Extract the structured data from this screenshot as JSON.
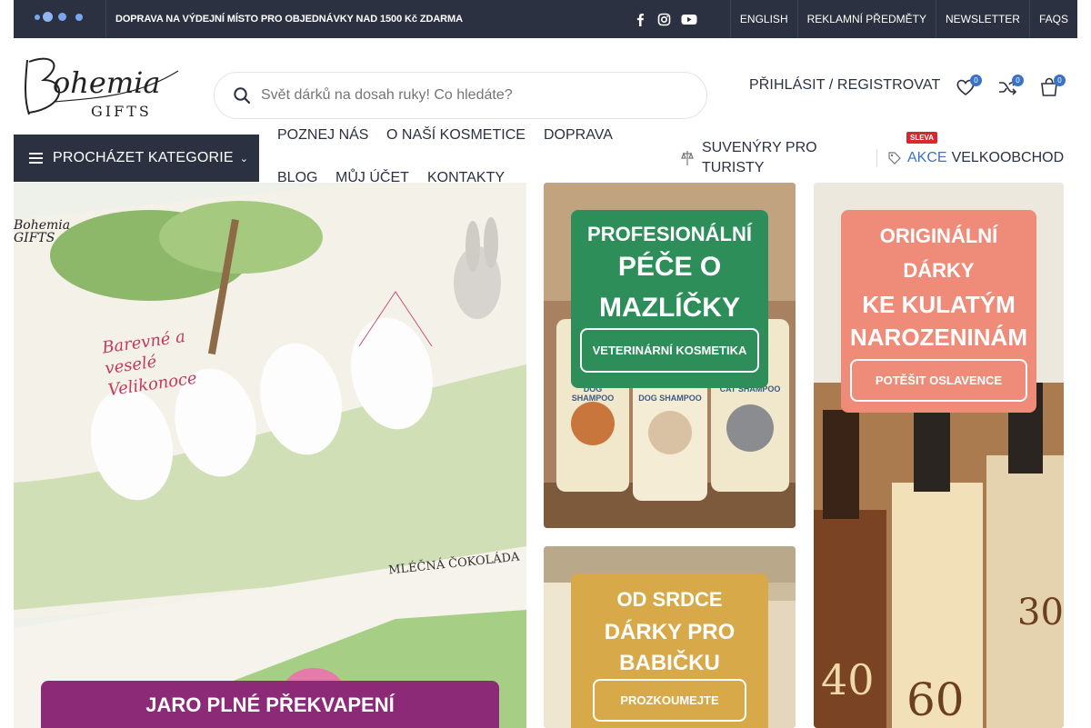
{
  "topbar": {
    "promo": "DOPRAVA NA VÝDEJNÍ MÍSTO PRO OBJEDNÁVKY NAD 1500 Kč ZDARMA",
    "links": [
      "ENGLISH",
      "REKLAMNÍ PŘEDMĚTY",
      "NEWSLETTER",
      "FAQS"
    ],
    "social_icons": [
      "facebook-icon",
      "instagram-icon",
      "youtube-icon"
    ]
  },
  "header": {
    "logo_text": "Bohemia GIFTS",
    "search_placeholder": "Svět dárků na dosah ruky! Co hledáte?",
    "login": "PŘIHLÁSIT / REGISTROVAT",
    "wishlist_count": "0",
    "compare_count": "0",
    "cart_count": "0"
  },
  "nav": {
    "categories_button": "PROCHÁZET KATEGORIE",
    "links": [
      "POZNEJ NÁS",
      "O NAŠÍ KOSMETICE",
      "DOPRAVA",
      "BLOG",
      "MŮJ ÚČET",
      "KONTAKTY"
    ],
    "souvenirs": "SUVENÝRY PRO TURISTY",
    "akce": "AKCE",
    "sleva_badge": "SLEVA",
    "wholesale": "VELKOOBCHOD"
  },
  "banners": {
    "easter": {
      "title": "JARO PLNÉ PŘEKVAPENÍ",
      "box_text_1": "Barevné a veselé Velikonoce",
      "box_text_2": "MLÉČNÁ ČOKOLÁDA",
      "logo_text": "Bohemia GIFTS"
    },
    "pets": {
      "sub": "PROFESIONÁLNÍ",
      "main": "PÉČE O MAZLÍČKY",
      "button": "VETERINÁRNÍ KOSMETIKA",
      "labels": [
        "DOG SHAMPOO",
        "DOG SHAMPOO",
        "CAT SHAMPOO"
      ]
    },
    "grandma": {
      "sub": "OD SRDCE",
      "main": "DÁRKY PRO BABIČKU",
      "button": "PROZKOUMEJTE"
    },
    "birthday": {
      "sub": "ORIGINÁLNÍ DÁRKY",
      "main": "KE KULATÝM NAROZENINÁM",
      "button": "POTĚŠIT OSLAVENCE",
      "bottle_numbers": [
        "40",
        "60",
        "30"
      ]
    }
  },
  "colors": {
    "topbar": "#2b3140",
    "accent_blue": "#3a72c8",
    "easter_purple": "#8c2a78",
    "pets_green": "#2e8e5a",
    "grandma_gold": "#d7a948",
    "birthday_salmon": "#ef8b79",
    "sleva_red": "#d8282f"
  }
}
